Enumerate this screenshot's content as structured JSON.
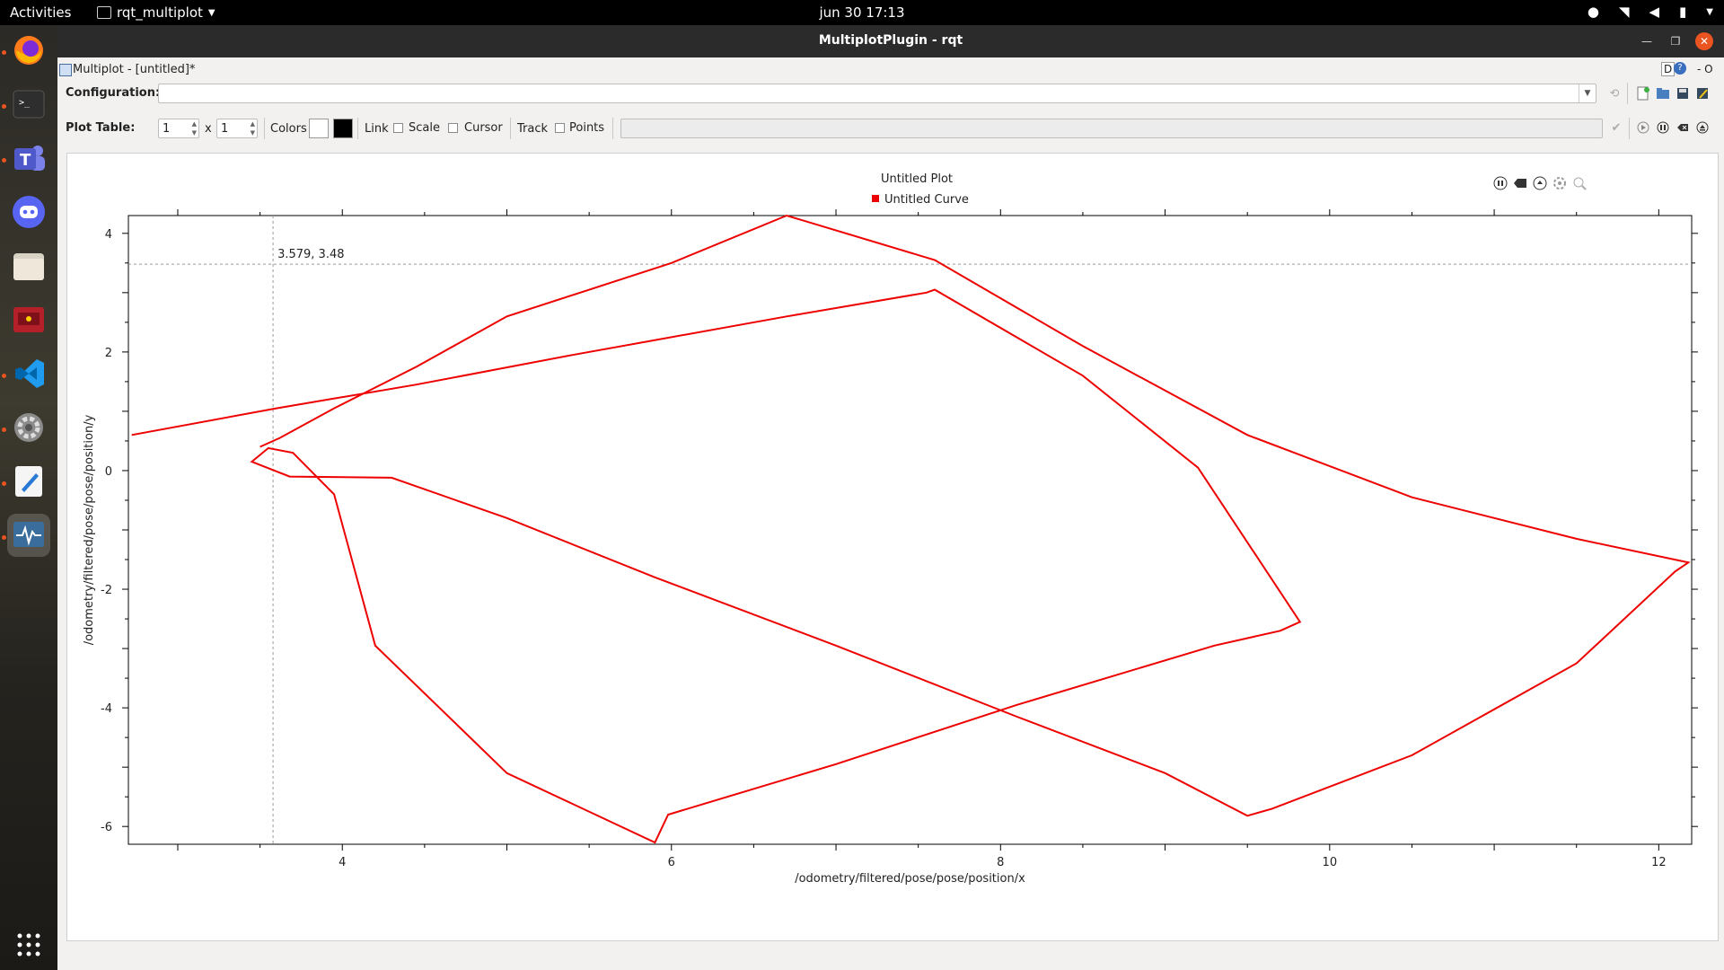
{
  "topbar": {
    "activities": "Activities",
    "app_menu": "rqt_multiplot",
    "clock": "jun 30  17:13"
  },
  "window": {
    "title": "MultiplotPlugin - rqt",
    "dock_title": "Multiplot - [untitled]*",
    "dock_buttons": "D",
    "dock_extra": "- O"
  },
  "config": {
    "label": "Configuration:",
    "value": ""
  },
  "plot_table": {
    "label": "Plot Table:",
    "rows": "1",
    "x_label": "x",
    "cols": "1",
    "colors_label": "Colors",
    "link_label": "Link",
    "scale_label": "Scale",
    "cursor_label": "Cursor",
    "track_label": "Track",
    "points_label": "Points",
    "bg_color": "#ffffff",
    "fg_color": "#000000"
  },
  "plot": {
    "title": "Untitled Plot",
    "legend": "Untitled Curve",
    "curve_color": "#ee0000",
    "cursor_readout": "3.579, 3.48"
  },
  "chart_data": {
    "type": "line",
    "title": "Untitled Plot",
    "xlabel": "/odometry/filtered/pose/pose/position/x",
    "ylabel": "/odometry/filtered/pose/pose/position/y",
    "xlim": [
      2.7,
      12.2
    ],
    "ylim": [
      -6.3,
      4.3
    ],
    "xticks": [
      4,
      6,
      8,
      10,
      12
    ],
    "yticks": [
      -6,
      -4,
      -2,
      0,
      2,
      4
    ],
    "legend_position": "top-center",
    "grid": false,
    "cursor": {
      "x": 3.579,
      "y": 3.48
    },
    "series": [
      {
        "name": "Untitled Curve",
        "color": "#ee0000",
        "x": [
          2.72,
          3.6,
          4.45,
          5.4,
          6.7,
          7.55,
          7.6,
          8.5,
          9.2,
          9.82,
          9.7,
          9.3,
          8.1,
          7.0,
          5.98,
          5.9,
          5.0,
          4.2,
          3.95,
          3.7,
          3.55,
          3.45,
          3.68,
          4.3,
          5.0,
          5.9,
          7.0,
          8.1,
          9.0,
          9.5,
          9.65,
          10.5,
          11.5,
          12.1,
          12.18,
          11.5,
          10.5,
          9.5,
          8.5,
          7.6,
          6.7,
          6.0,
          5.0,
          4.45,
          3.95,
          3.62,
          3.5
        ],
        "y": [
          0.6,
          1.05,
          1.45,
          1.95,
          2.6,
          3.0,
          3.05,
          1.6,
          0.05,
          -2.55,
          -2.7,
          -2.95,
          -3.95,
          -4.95,
          -5.8,
          -6.27,
          -5.1,
          -2.95,
          -0.4,
          0.3,
          0.38,
          0.15,
          -0.1,
          -0.12,
          -0.8,
          -1.8,
          -2.95,
          -4.15,
          -5.1,
          -5.82,
          -5.7,
          -4.8,
          -3.25,
          -1.7,
          -1.55,
          -1.15,
          -0.45,
          0.6,
          2.1,
          3.55,
          4.3,
          3.5,
          2.6,
          1.75,
          1.05,
          0.55,
          0.4
        ]
      }
    ]
  }
}
